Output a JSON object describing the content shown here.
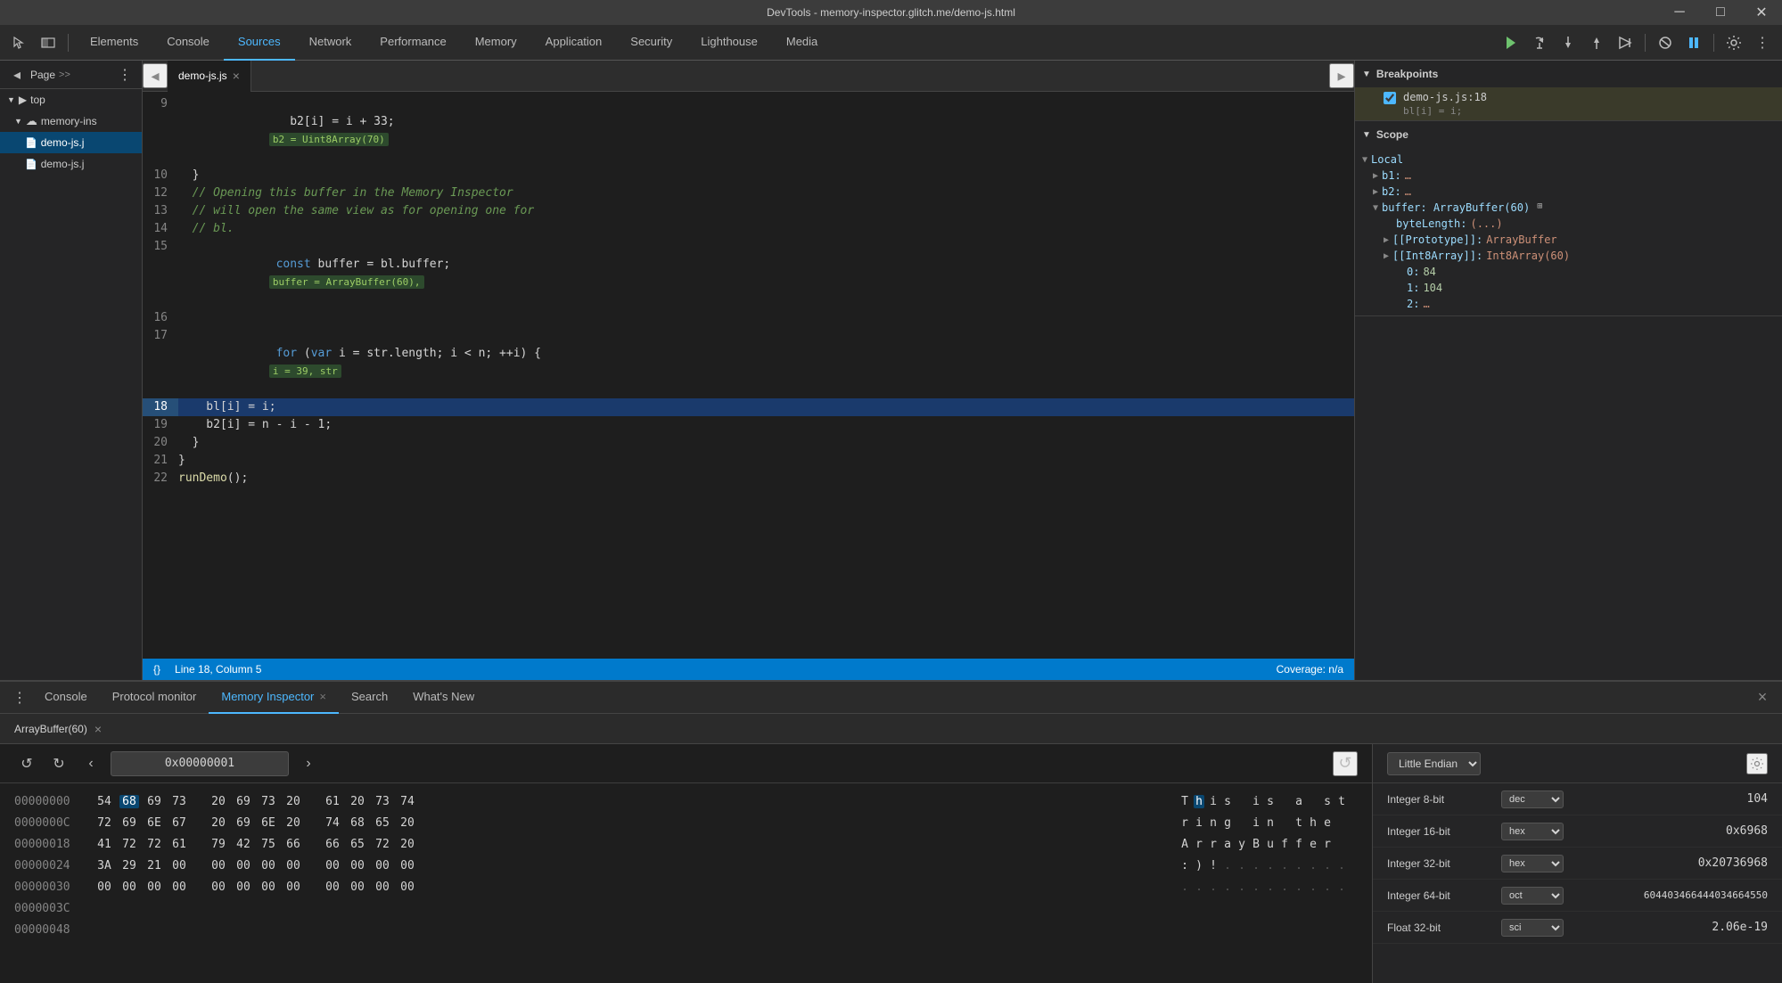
{
  "window": {
    "title": "DevTools - memory-inspector.glitch.me/demo-js.html",
    "controls": {
      "minimize": "─",
      "maximize": "□",
      "close": "✕"
    }
  },
  "devtools": {
    "toolbar": {
      "icons": {
        "cursor": "⊹",
        "dock": "⧉"
      }
    },
    "tabs": [
      {
        "label": "Elements",
        "active": false
      },
      {
        "label": "Console",
        "active": false
      },
      {
        "label": "Sources",
        "active": true
      },
      {
        "label": "Network",
        "active": false
      },
      {
        "label": "Performance",
        "active": false
      },
      {
        "label": "Memory",
        "active": false
      },
      {
        "label": "Application",
        "active": false
      },
      {
        "label": "Security",
        "active": false
      },
      {
        "label": "Lighthouse",
        "active": false
      },
      {
        "label": "Media",
        "active": false
      }
    ],
    "debug_controls": {
      "resume": "▶",
      "step_over": "↺",
      "step_into": "↓",
      "step_out": "↑",
      "step_back": "→",
      "activate": "✎",
      "pause": "⏸"
    },
    "settings_icon": "⚙",
    "more_icon": "⋮"
  },
  "sidebar": {
    "header": {
      "toggle": "☰",
      "back": "◂"
    },
    "tabs": {
      "page_label": "Page",
      "more": ">>"
    },
    "items": [
      {
        "label": "top",
        "indent": 0,
        "icon": "▼▶",
        "type": "folder"
      },
      {
        "label": "memory-ins",
        "indent": 1,
        "icon": "☁",
        "type": "cloud"
      },
      {
        "label": "demo-js.js",
        "indent": 2,
        "icon": "📄",
        "type": "file",
        "active": true
      },
      {
        "label": "demo-js.js",
        "indent": 2,
        "icon": "📄",
        "type": "file"
      }
    ]
  },
  "editor": {
    "file": "demo-js.js",
    "status": {
      "line": "Line 18, Column 5",
      "coverage": "Coverage: n/a"
    },
    "lines": [
      {
        "num": "9",
        "code": "    b2[i] = i + 33;",
        "inline": "b2 = Uint8Array(70)"
      },
      {
        "num": "10",
        "code": "  }"
      },
      {
        "num": "12",
        "code": "  // Opening this buffer in the Memory Inspector",
        "type": "comment"
      },
      {
        "num": "13",
        "code": "  // will open the same view as for opening one for",
        "type": "comment"
      },
      {
        "num": "14",
        "code": "  // bl.",
        "type": "comment"
      },
      {
        "num": "15",
        "code": "  const buffer = bl.buffer;",
        "inline": "buffer = ArrayBuffer(60),"
      },
      {
        "num": "16",
        "code": ""
      },
      {
        "num": "17",
        "code": "  for (var i = str.length; i < n; ++i) {",
        "inline": "i = 39, str"
      },
      {
        "num": "18",
        "code": "    bl[i] = i;",
        "highlighted": true,
        "selected": true
      },
      {
        "num": "19",
        "code": "    b2[i] = n - i - 1;"
      },
      {
        "num": "20",
        "code": "  }"
      },
      {
        "num": "21",
        "code": "}"
      },
      {
        "num": "22",
        "code": "runDemo();"
      }
    ]
  },
  "breakpoints_panel": {
    "title": "Breakpoints",
    "items": [
      {
        "file": "demo-js.js:18",
        "code": "bl[i] = i;",
        "checked": true
      }
    ]
  },
  "scope_panel": {
    "title": "Scope",
    "local": {
      "label": "Local",
      "items": [
        {
          "key": "b1:",
          "value": "…",
          "indent": 1,
          "expanded": false
        },
        {
          "key": "b2:",
          "value": "…",
          "indent": 1,
          "expanded": false
        },
        {
          "key": "buffer: ArrayBuffer(60)",
          "value": "",
          "indent": 1,
          "expanded": true,
          "has_icon": true
        },
        {
          "key": "byteLength: (...)",
          "value": "",
          "indent": 2
        },
        {
          "key": "[[Prototype]]:",
          "value": "ArrayBuffer",
          "indent": 2,
          "expandable": true
        },
        {
          "key": "[[Int8Array]]:",
          "value": "Int8Array(60)",
          "indent": 2,
          "expandable": true
        },
        {
          "key": "0:",
          "value": "84",
          "indent": 3
        },
        {
          "key": "1:",
          "value": "104",
          "indent": 3
        },
        {
          "key": "2:",
          "value": "…",
          "indent": 3
        }
      ]
    }
  },
  "bottom_panel": {
    "tabs": [
      {
        "label": "Console",
        "active": false
      },
      {
        "label": "Protocol monitor",
        "active": false
      },
      {
        "label": "Memory Inspector",
        "active": true,
        "closable": true
      },
      {
        "label": "Search",
        "active": false
      },
      {
        "label": "What's New",
        "active": false
      }
    ],
    "more_icon": "⋮",
    "close_icon": "✕",
    "buffer_tab": {
      "label": "ArrayBuffer(60)",
      "closable": true
    }
  },
  "memory_inspector": {
    "toolbar": {
      "prev": "‹",
      "next": "›",
      "address": "0x00000001",
      "refresh": "↺"
    },
    "rows": [
      {
        "addr": "00000000",
        "bytes": [
          "54",
          "68",
          "69",
          "73",
          "20",
          "69",
          "73",
          "20",
          "61",
          "20",
          "73",
          "74"
        ],
        "ascii": [
          "T",
          "h",
          "i",
          "s",
          " ",
          "i",
          "s",
          " ",
          "a",
          " ",
          "s",
          "t"
        ],
        "selected_byte": 1
      },
      {
        "addr": "0000000C",
        "bytes": [
          "72",
          "69",
          "6E",
          "67",
          "20",
          "69",
          "6E",
          "20",
          "74",
          "68",
          "65",
          "20"
        ],
        "ascii": [
          "r",
          "i",
          "n",
          "g",
          " ",
          "i",
          "n",
          " ",
          "t",
          "h",
          "e",
          " "
        ]
      },
      {
        "addr": "00000018",
        "bytes": [
          "41",
          "72",
          "72",
          "61",
          "79",
          "42",
          "75",
          "66",
          "66",
          "65",
          "72",
          "20"
        ],
        "ascii": [
          "A",
          "r",
          "r",
          "a",
          "y",
          "B",
          "u",
          "f",
          "f",
          "e",
          "r",
          " "
        ]
      },
      {
        "addr": "00000024",
        "bytes": [
          "3A",
          "29",
          "21",
          "00",
          "00",
          "00",
          "00",
          "00",
          "00",
          "00",
          "00",
          "00"
        ],
        "ascii": [
          ":",
          ")",
          "!",
          ".",
          ".",
          ".",
          ".",
          ".",
          ".",
          ".",
          ".",
          "."
        ]
      },
      {
        "addr": "00000030",
        "bytes": [
          "00",
          "00",
          "00",
          "00",
          "00",
          "00",
          "00",
          "00",
          "00",
          "00",
          "00",
          "00"
        ],
        "ascii": [
          ".",
          ".",
          ".",
          ".",
          ".",
          ".",
          ".",
          ".",
          ".",
          ".",
          ".",
          "."
        ]
      },
      {
        "addr": "0000003C",
        "bytes": [],
        "ascii": []
      },
      {
        "addr": "00000048",
        "bytes": [],
        "ascii": []
      }
    ],
    "right_panel": {
      "endian": "Little Endian",
      "settings_icon": "⚙",
      "data_rows": [
        {
          "type": "Integer 8-bit",
          "format": "dec",
          "value": "104",
          "formats": [
            "dec",
            "hex",
            "oct",
            "sci"
          ]
        },
        {
          "type": "Integer 16-bit",
          "format": "hex",
          "value": "0x6968",
          "formats": [
            "dec",
            "hex",
            "oct",
            "sci"
          ]
        },
        {
          "type": "Integer 32-bit",
          "format": "hex",
          "value": "0x20736968",
          "formats": [
            "dec",
            "hex",
            "oct",
            "sci"
          ]
        },
        {
          "type": "Integer 64-bit",
          "format": "oct",
          "value": "604403466444034664550",
          "formats": [
            "dec",
            "hex",
            "oct",
            "sci"
          ]
        },
        {
          "type": "Float 32-bit",
          "format": "sci",
          "value": "2.06e-19",
          "formats": [
            "dec",
            "hex",
            "oct",
            "sci"
          ]
        }
      ]
    }
  }
}
